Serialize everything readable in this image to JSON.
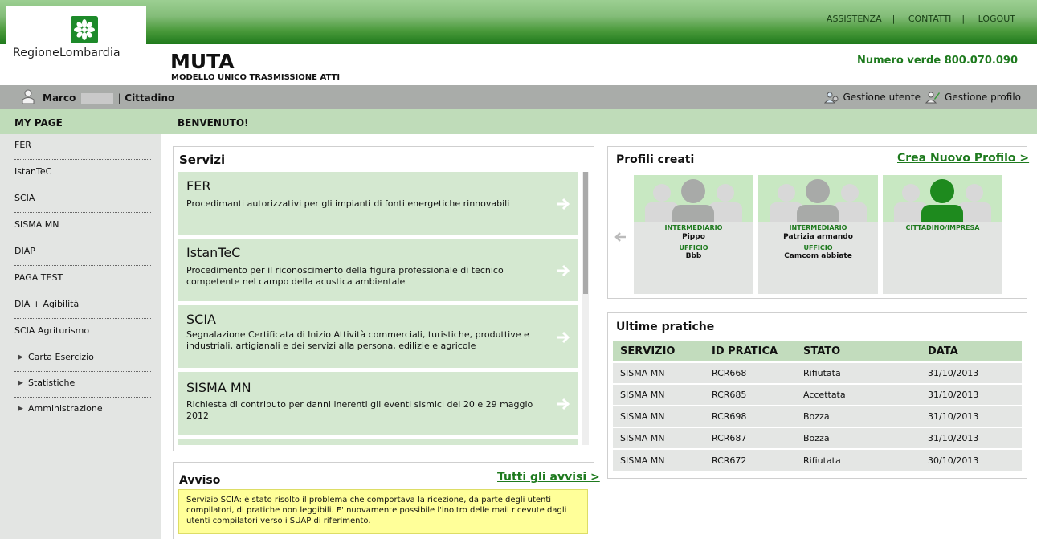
{
  "header": {
    "links": [
      "ASSISTENZA",
      "CONTATTI",
      "LOGOUT"
    ],
    "separator": "|",
    "logo_text": "RegioneLombardia",
    "app_title": "MUTA",
    "app_subtitle": "MODELLO UNICO TRASMISSIONE ATTI",
    "phone": "Numero verde 800.070.090"
  },
  "userbar": {
    "first_name": "Marco",
    "role": "| Cittadino",
    "gestione_utente": "Gestione utente",
    "gestione_profilo": "Gestione profilo"
  },
  "sidebar": {
    "title": "MY PAGE",
    "items": [
      {
        "label": "FER"
      },
      {
        "label": "IstanTeC"
      },
      {
        "label": "SCIA"
      },
      {
        "label": "SISMA MN"
      },
      {
        "label": "DIAP"
      },
      {
        "label": "PAGA TEST"
      },
      {
        "label": "DIA + Agibilità"
      },
      {
        "label": "SCIA Agriturismo"
      }
    ],
    "expandable": [
      {
        "label": "Carta Esercizio"
      },
      {
        "label": "Statistiche"
      },
      {
        "label": "Amministrazione"
      }
    ]
  },
  "main": {
    "welcome": "BENVENUTO!",
    "servizi": {
      "title": "Servizi",
      "items": [
        {
          "title": "FER",
          "desc": "Procedimanti autorizzativi per gli impianti di fonti energetiche rinnovabili"
        },
        {
          "title": "IstanTeC",
          "desc": "Procedimento per il riconoscimento della figura professionale di tecnico competente nel campo della acustica ambientale"
        },
        {
          "title": "SCIA",
          "desc": "Segnalazione Certificata di Inizio Attività commerciali, turistiche, produttive e industriali, artigianali e dei servizi alla persona, edilizie e agricole"
        },
        {
          "title": "SISMA MN",
          "desc": "Richiesta di contributo per danni inerenti gli eventi sismici del 20 e 29 maggio 2012"
        }
      ]
    },
    "avviso": {
      "title": "Avviso",
      "link": "Tutti gli avvisi >",
      "text": "Servizio SCIA: è stato risolto il problema che comportava la ricezione, da parte degli utenti compilatori, di pratiche non leggibili. E' nuovamente possibile l'inoltro delle mail ricevute dagli utenti compilatori verso i SUAP di riferimento."
    },
    "profili": {
      "title": "Profili creati",
      "link": "Crea Nuovo Profilo >",
      "cards": [
        {
          "type": "INTERMEDIARIO",
          "name": "Pippo",
          "ufficio_label": "UFFICIO",
          "ufficio": "Bbb",
          "active": false
        },
        {
          "type": "INTERMEDIARIO",
          "name": "Patrizia armando",
          "ufficio_label": "UFFICIO",
          "ufficio": "Camcom abbiate",
          "active": false
        },
        {
          "type": "CITTADINO/IMPRESA",
          "name": "",
          "ufficio_label": "",
          "ufficio": "",
          "active": true
        }
      ]
    },
    "pratiche": {
      "title": "Ultime pratiche",
      "columns": [
        "SERVIZIO",
        "ID PRATICA",
        "STATO",
        "DATA"
      ],
      "rows": [
        [
          "SISMA MN",
          "RCR668",
          "Rifiutata",
          "31/10/2013"
        ],
        [
          "SISMA MN",
          "RCR685",
          "Accettata",
          "31/10/2013"
        ],
        [
          "SISMA MN",
          "RCR698",
          "Bozza",
          "31/10/2013"
        ],
        [
          "SISMA MN",
          "RCR687",
          "Bozza",
          "31/10/2013"
        ],
        [
          "SISMA MN",
          "RCR672",
          "Rifiutata",
          "30/10/2013"
        ]
      ]
    }
  },
  "icons": [
    "user-icon",
    "gear-user-icon",
    "profile-edit-icon",
    "arrow-right-icon",
    "arrow-left-icon",
    "triangle-right-icon"
  ],
  "colors": {
    "accent": "#1e7a1e",
    "light_green": "#bfdcb9",
    "service_bg": "#d4e8d0",
    "notice_bg": "#ffff99"
  }
}
